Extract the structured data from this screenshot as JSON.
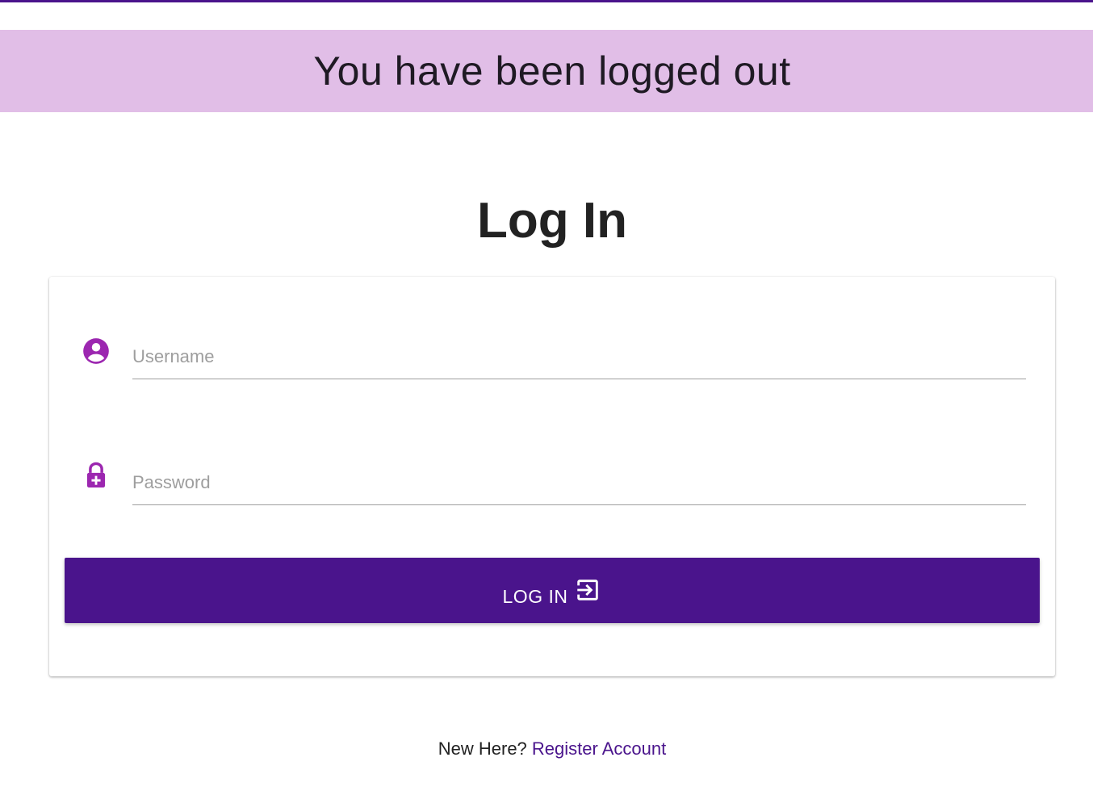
{
  "banner": {
    "message": "You have been logged out"
  },
  "page": {
    "title": "Log In"
  },
  "form": {
    "username": {
      "placeholder": "Username",
      "value": "",
      "icon": "account-circle-icon"
    },
    "password": {
      "placeholder": "Password",
      "value": "",
      "icon": "lock-plus-icon"
    },
    "submit": {
      "label": "LOG IN",
      "icon": "login-icon"
    }
  },
  "footer": {
    "prompt": "New Here?",
    "link_label": "Register Account"
  },
  "colors": {
    "accent": "#4a148c",
    "icon": "#9c27b0",
    "banner_bg": "#e1bee7"
  }
}
